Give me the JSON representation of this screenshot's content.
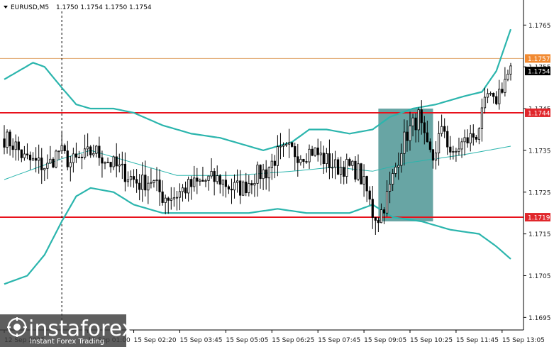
{
  "header": {
    "symbol": "EURUSD,M5",
    "ohlc": "1.1750 1.1754 1.1750 1.1754"
  },
  "watermark": {
    "brand": "instaforex",
    "tagline": "Instant Forex Trading"
  },
  "colors": {
    "background": "#ffffff",
    "candle": "#000000",
    "bollinger": "#2bb5ad",
    "level_line": "#e8101a",
    "upper_line": "#e0a56a",
    "zone_fill": "#3d8c8a",
    "tag_red": "#e0262b",
    "tag_orange": "#f18a32",
    "tag_black": "#000000"
  },
  "chart_data": {
    "type": "candlestick",
    "symbol": "EURUSD",
    "timeframe": "M5",
    "ylim": [
      1.1692,
      1.1771
    ],
    "yticks": [
      "1.1765",
      "1.1755",
      "1.1745",
      "1.1735",
      "1.1725",
      "1.1715",
      "1.1705",
      "1.1695"
    ],
    "ytick_values": [
      1.1765,
      1.1755,
      1.1745,
      1.1735,
      1.1725,
      1.1715,
      1.1705,
      1.1695
    ],
    "xticks": [
      "12 Sep 2025",
      "15 Sep 01:00",
      "15 Sep 02:20",
      "15 Sep 03:45",
      "15 Sep 05:05",
      "15 Sep 06:25",
      "15 Sep 07:45",
      "15 Sep 09:05",
      "15 Sep 10:25",
      "15 Sep 11:45",
      "15 Sep 13:05"
    ],
    "xtick_bars": [
      0,
      29,
      45,
      61,
      77,
      93,
      109,
      125,
      141,
      157,
      173
    ],
    "bar_count": 177,
    "grid": false,
    "session_separator_bar": 20,
    "levels": [
      {
        "label": "1.1744",
        "value": 1.1744,
        "style": "red"
      },
      {
        "label": "1.1719",
        "value": 1.1719,
        "style": "red"
      },
      {
        "label": "1.1757",
        "value": 1.1757,
        "style": "orange"
      }
    ],
    "current_price": {
      "label": "1.1754",
      "value": 1.1754
    },
    "zone": {
      "x_start": 130,
      "x_end": 149,
      "y_low": 1.1718,
      "y_high": 1.1745
    },
    "close_anchors": [
      [
        0,
        1.1738
      ],
      [
        4,
        1.1736
      ],
      [
        7,
        1.1733
      ],
      [
        11,
        1.1732
      ],
      [
        15,
        1.1731
      ],
      [
        19,
        1.1735
      ],
      [
        23,
        1.1732
      ],
      [
        27,
        1.1733
      ],
      [
        31,
        1.1735
      ],
      [
        35,
        1.1733
      ],
      [
        39,
        1.1731
      ],
      [
        43,
        1.1729
      ],
      [
        47,
        1.1727
      ],
      [
        51,
        1.1728
      ],
      [
        55,
        1.1724
      ],
      [
        59,
        1.1724
      ],
      [
        63,
        1.1726
      ],
      [
        67,
        1.1727
      ],
      [
        71,
        1.1728
      ],
      [
        75,
        1.1728
      ],
      [
        79,
        1.1726
      ],
      [
        83,
        1.1726
      ],
      [
        87,
        1.1729
      ],
      [
        91,
        1.173
      ],
      [
        95,
        1.1734
      ],
      [
        99,
        1.1735
      ],
      [
        103,
        1.1734
      ],
      [
        107,
        1.1735
      ],
      [
        111,
        1.1733
      ],
      [
        115,
        1.1731
      ],
      [
        119,
        1.1731
      ],
      [
        123,
        1.173
      ],
      [
        126,
        1.1725
      ],
      [
        128,
        1.172
      ],
      [
        130,
        1.1719
      ],
      [
        132,
        1.1722
      ],
      [
        134,
        1.1726
      ],
      [
        136,
        1.1731
      ],
      [
        138,
        1.1736
      ],
      [
        140,
        1.1739
      ],
      [
        142,
        1.1741
      ],
      [
        144,
        1.1743
      ],
      [
        145,
        1.174
      ],
      [
        146,
        1.1737
      ],
      [
        147,
        1.1735
      ],
      [
        149,
        1.1733
      ],
      [
        151,
        1.1738
      ],
      [
        153,
        1.174
      ],
      [
        154,
        1.1737
      ],
      [
        156,
        1.1733
      ],
      [
        158,
        1.1736
      ],
      [
        160,
        1.1737
      ],
      [
        162,
        1.1738
      ],
      [
        164,
        1.1739
      ],
      [
        166,
        1.1743
      ],
      [
        168,
        1.1748
      ],
      [
        170,
        1.1746
      ],
      [
        172,
        1.1749
      ],
      [
        174,
        1.1752
      ],
      [
        176,
        1.1754
      ]
    ],
    "series": [
      {
        "kind": "bollinger_middle",
        "points": [
          [
            0,
            1.1728
          ],
          [
            20,
            1.1733
          ],
          [
            30,
            1.1735
          ],
          [
            45,
            1.1732
          ],
          [
            60,
            1.1729
          ],
          [
            80,
            1.1729
          ],
          [
            100,
            1.173
          ],
          [
            115,
            1.1731
          ],
          [
            128,
            1.173
          ],
          [
            140,
            1.1732
          ],
          [
            150,
            1.1733
          ],
          [
            160,
            1.1734
          ],
          [
            176,
            1.1736
          ]
        ]
      },
      {
        "kind": "bollinger_upper",
        "points": [
          [
            0,
            1.1752
          ],
          [
            10,
            1.1756
          ],
          [
            14,
            1.1755
          ],
          [
            20,
            1.175
          ],
          [
            25,
            1.1746
          ],
          [
            30,
            1.1745
          ],
          [
            38,
            1.1745
          ],
          [
            45,
            1.1744
          ],
          [
            55,
            1.1741
          ],
          [
            65,
            1.1739
          ],
          [
            75,
            1.1738
          ],
          [
            90,
            1.1735
          ],
          [
            100,
            1.1737
          ],
          [
            106,
            1.174
          ],
          [
            112,
            1.174
          ],
          [
            120,
            1.1739
          ],
          [
            128,
            1.174
          ],
          [
            134,
            1.1743
          ],
          [
            142,
            1.1745
          ],
          [
            150,
            1.1746
          ],
          [
            160,
            1.1748
          ],
          [
            166,
            1.1749
          ],
          [
            171,
            1.1754
          ],
          [
            176,
            1.1764
          ]
        ]
      },
      {
        "kind": "bollinger_lower",
        "points": [
          [
            0,
            1.1703
          ],
          [
            8,
            1.1705
          ],
          [
            14,
            1.171
          ],
          [
            20,
            1.1718
          ],
          [
            25,
            1.1724
          ],
          [
            30,
            1.1726
          ],
          [
            38,
            1.1725
          ],
          [
            45,
            1.1722
          ],
          [
            55,
            1.172
          ],
          [
            65,
            1.172
          ],
          [
            75,
            1.172
          ],
          [
            85,
            1.172
          ],
          [
            95,
            1.1721
          ],
          [
            105,
            1.172
          ],
          [
            112,
            1.172
          ],
          [
            120,
            1.172
          ],
          [
            128,
            1.1722
          ],
          [
            135,
            1.1719
          ],
          [
            145,
            1.1718
          ],
          [
            155,
            1.1716
          ],
          [
            165,
            1.1715
          ],
          [
            171,
            1.1712
          ],
          [
            176,
            1.1709
          ]
        ]
      }
    ]
  }
}
